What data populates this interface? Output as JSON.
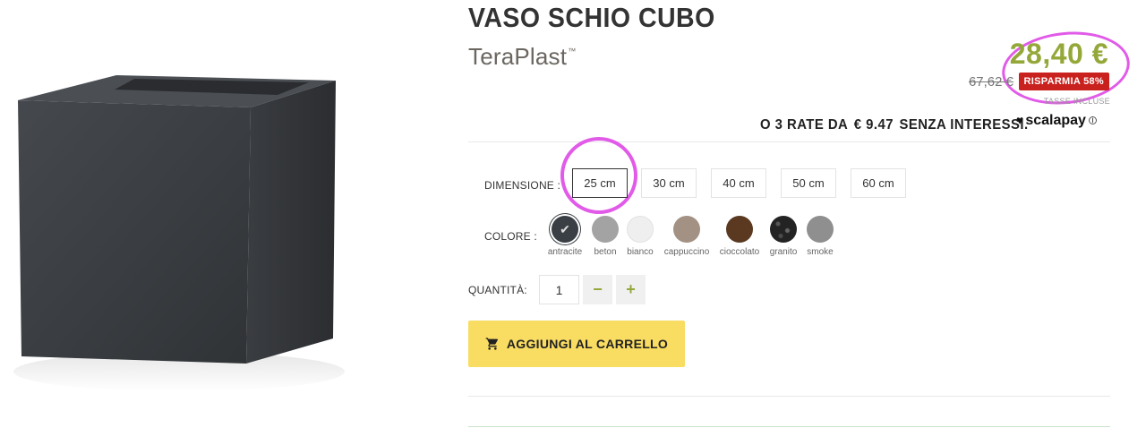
{
  "product": {
    "title": "VASO SCHIO CUBO",
    "brand": "TeraPlast",
    "brand_mark": "™"
  },
  "pricing": {
    "price": "28,40 €",
    "old_price": "67,62 €",
    "savings_badge": "RISPARMIA 58%",
    "tax_note": "TASSE INCLUSE"
  },
  "installments": {
    "text": "O 3 RATE DA",
    "amount": "€ 9.47",
    "suffix": "SENZA INTERESSI.",
    "provider": "scalapay",
    "info_icon": "i"
  },
  "options": {
    "dimension_label": "DIMENSIONE :",
    "sizes": [
      "25 cm",
      "30 cm",
      "40 cm",
      "50 cm",
      "60 cm"
    ],
    "selected_size": "25 cm",
    "color_label": "COLORE :",
    "colors": [
      {
        "name": "antracite",
        "hex": "#3a3f45",
        "selected": true
      },
      {
        "name": "beton",
        "hex": "#a3a3a3"
      },
      {
        "name": "bianco",
        "hex": "#efefef"
      },
      {
        "name": "cappuccino",
        "hex": "#a39183"
      },
      {
        "name": "cioccolato",
        "hex": "#5a3920"
      },
      {
        "name": "granito",
        "hex": "#2a2a2a"
      },
      {
        "name": "smoke",
        "hex": "#8f8f8f"
      }
    ]
  },
  "quantity": {
    "label": "QUANTITÀ:",
    "value": "1",
    "minus": "−",
    "plus": "+"
  },
  "cart": {
    "label": "AGGIUNGI AL CARRELLO",
    "icon": "cart-icon"
  },
  "colors": {
    "price_green": "#94a83a",
    "badge_red": "#c9211e",
    "cart_yellow": "#f9dc62",
    "highlight_pink": "#e15ae8"
  }
}
